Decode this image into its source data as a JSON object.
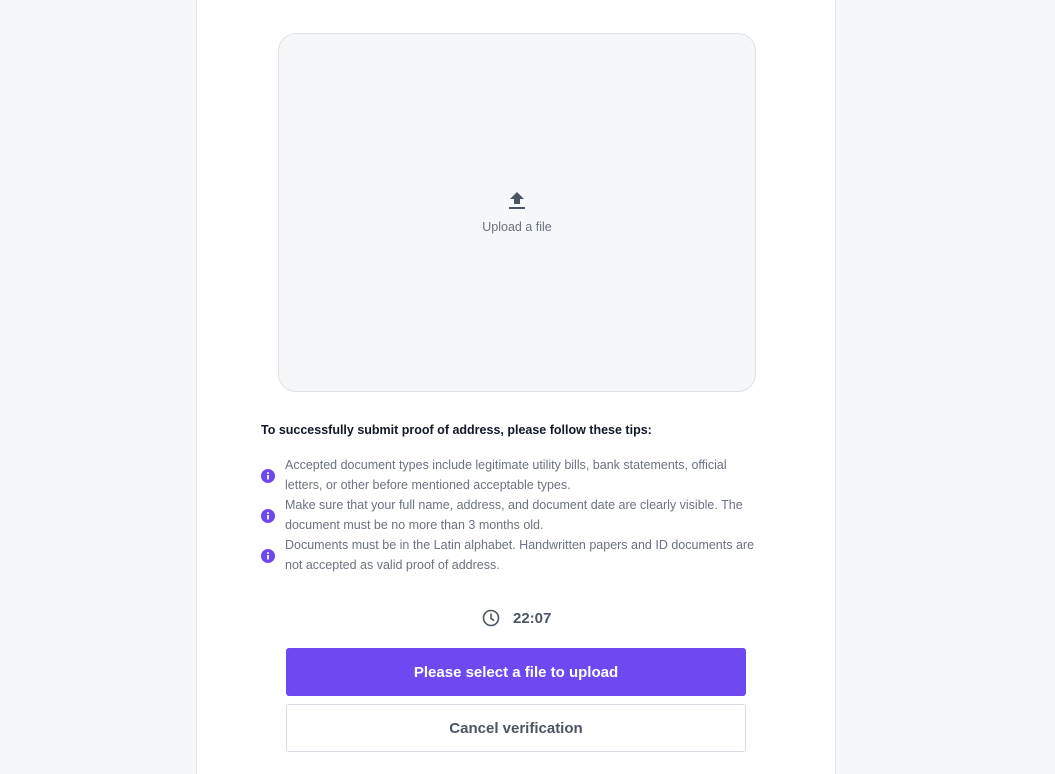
{
  "upload": {
    "label": "Upload a file",
    "icon": "upload-icon"
  },
  "tips": {
    "title": "To successfully submit proof of address, please follow these tips:",
    "icon": "info-icon",
    "accent": "#6e49f2",
    "items": [
      {
        "line1": "Accepted document types include legitimate utility bills, bank statements, official",
        "line2": "letters, or other before mentioned acceptable types."
      },
      {
        "line1": "Make sure that your full name, address, and document date are clearly visible. The",
        "line2": "document must be no more than 3 months old."
      },
      {
        "line1": "Documents must be in the Latin alphabet. Handwritten papers and ID documents are",
        "line2": "not accepted as valid proof of address."
      }
    ]
  },
  "timer": {
    "icon": "clock-icon",
    "value": "22:07"
  },
  "actions": {
    "primary_label": "Please select a file to upload",
    "cancel_label": "Cancel verification",
    "primary_color": "#6e49f2"
  }
}
